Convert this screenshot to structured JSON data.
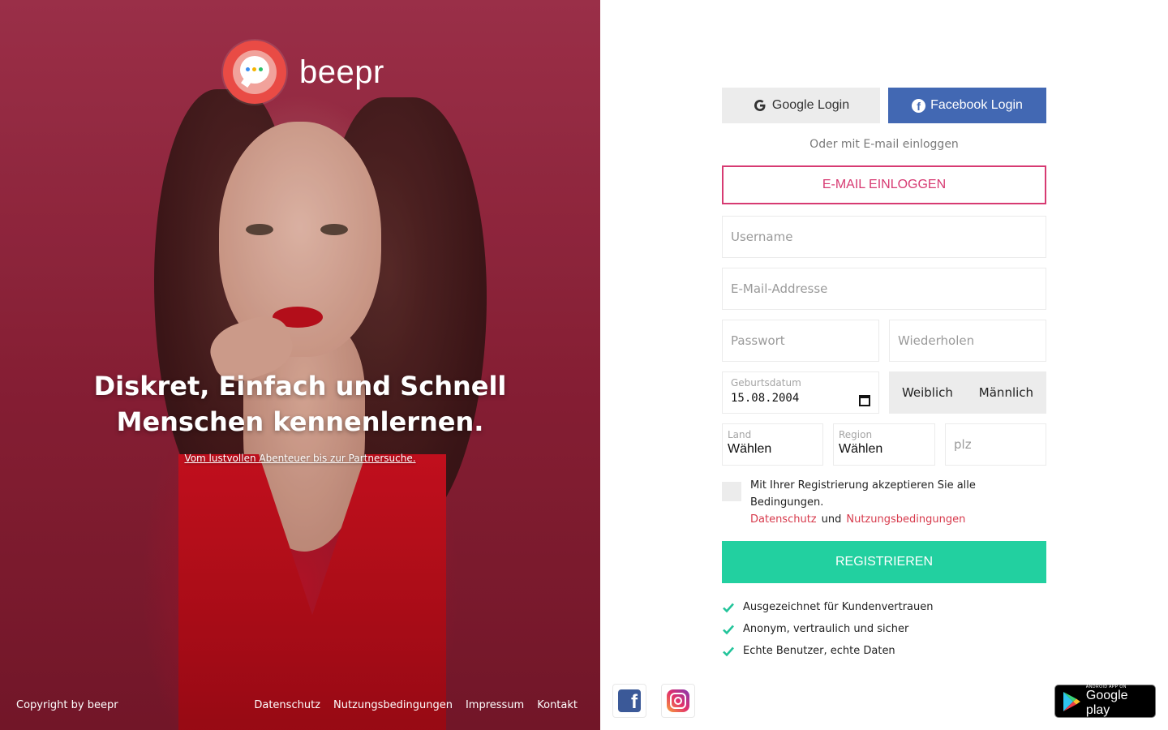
{
  "brand": {
    "name": "beepr"
  },
  "hero": {
    "headline_line1": "Diskret, Einfach und Schnell",
    "headline_line2": "Menschen kennenlernen.",
    "subline": "Vom lustvollen Abenteuer bis zur Partnersuche.",
    "copyright": "Copyright by beepr",
    "footer_links": [
      "Datenschutz",
      "Nutzungsbedingungen",
      "Impressum",
      "Kontakt"
    ]
  },
  "login": {
    "google_label": "Google Login",
    "facebook_label": "Facebook Login",
    "or_text": "Oder mit E-mail einloggen",
    "email_login_label": "E-MAIL EINLOGGEN"
  },
  "form": {
    "username_placeholder": "Username",
    "email_placeholder": "E-Mail-Addresse",
    "password_placeholder": "Passwort",
    "repeat_placeholder": "Wiederholen",
    "birthdate_label": "Geburtsdatum",
    "birthdate_value": "15.08.2004",
    "gender_female": "Weiblich",
    "gender_male": "Männlich",
    "country_label": "Land",
    "country_value": "Wählen",
    "region_label": "Region",
    "region_value": "Wählen",
    "zip_placeholder": "plz",
    "terms_text": "Mit Ihrer Registrierung akzeptieren Sie alle Bedingungen.",
    "terms_privacy": "Datenschutz",
    "terms_and": "und",
    "terms_conditions": "Nutzungsbedingungen",
    "register_label": "REGISTRIEREN"
  },
  "features": [
    "Ausgezeichnet für Kundenvertrauen",
    "Anonym, vertraulich und sicher",
    "Echte Benutzer, echte Daten"
  ],
  "store": {
    "small": "ANDROID APP ON",
    "big": "Google play"
  },
  "colors": {
    "accent_pink": "#d73a72",
    "facebook_blue": "#4268b3",
    "register_green": "#22d0a0",
    "link_red": "#d73a4c",
    "hero_bg": "#8f2238"
  },
  "icons": [
    "google-icon",
    "facebook-icon",
    "calendar-icon",
    "check-icon",
    "facebook-square-icon",
    "instagram-icon",
    "google-play-icon"
  ]
}
